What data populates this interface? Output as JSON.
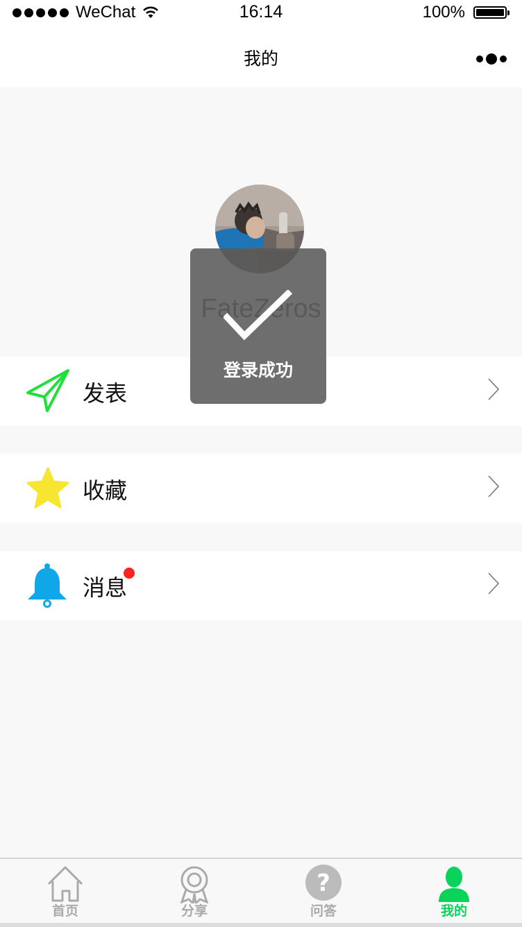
{
  "status_bar": {
    "carrier": "WeChat",
    "time": "16:14",
    "battery": "100%"
  },
  "nav": {
    "title": "我的",
    "more_icon": "more-dots-icon"
  },
  "profile": {
    "username": "FateZeros",
    "avatar_icon": "avatar-photo"
  },
  "menu": [
    {
      "label": "发表",
      "icon": "paper-plane-icon",
      "color": "#1fe03a"
    },
    {
      "label": "收藏",
      "icon": "star-icon",
      "color": "#f8e531"
    },
    {
      "label": "消息",
      "icon": "bell-icon",
      "color": "#10a7e8",
      "badge_color": "#f22"
    }
  ],
  "toast": {
    "message": "登录成功",
    "icon": "check-icon"
  },
  "tabs": [
    {
      "label": "首页",
      "icon": "home-icon",
      "active": false
    },
    {
      "label": "分享",
      "icon": "award-icon",
      "active": false
    },
    {
      "label": "问答",
      "icon": "question-icon",
      "active": false
    },
    {
      "label": "我的",
      "icon": "person-icon",
      "active": true
    }
  ],
  "colors": {
    "active_tab": "#09d35a",
    "inactive_tab": "#aaaaaa",
    "toast_bg": "#5a5a5a"
  }
}
